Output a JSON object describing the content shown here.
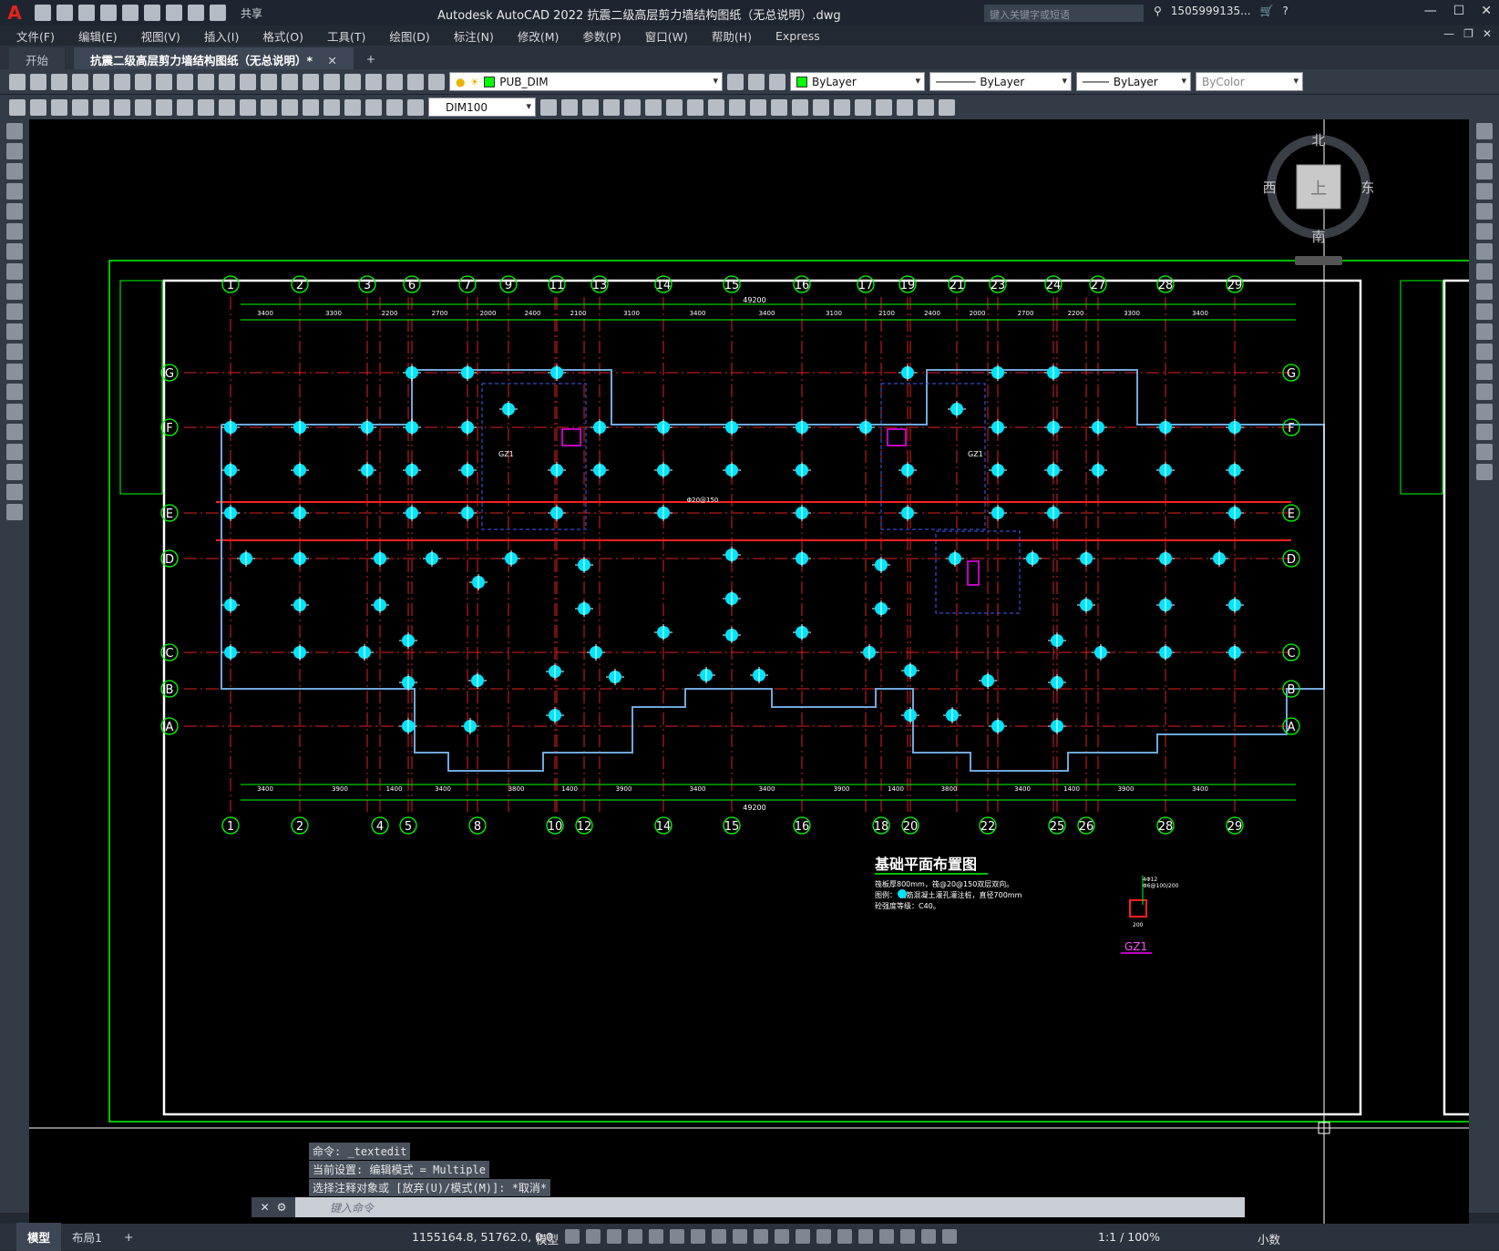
{
  "titlebar": {
    "app_title": "Autodesk AutoCAD 2022    抗震二级高层剪力墙结构图纸（无总说明）.dwg",
    "share_label": "共享",
    "search_placeholder": "键入关键字或短语",
    "user": "1505999135...",
    "logo": "A"
  },
  "menu": {
    "items": [
      "文件(F)",
      "编辑(E)",
      "视图(V)",
      "插入(I)",
      "格式(O)",
      "工具(T)",
      "绘图(D)",
      "标注(N)",
      "修改(M)",
      "参数(P)",
      "窗口(W)",
      "帮助(H)",
      "Express"
    ]
  },
  "tabs": {
    "start": "开始",
    "drawing": "抗震二级高层剪力墙结构图纸（无总说明）*"
  },
  "toolbar": {
    "layer_name": "PUB_DIM",
    "color": "ByLayer",
    "linetype": "ByLayer",
    "lineweight": "ByLayer",
    "plotstyle": "ByColor",
    "dimstyle": "DIM100",
    "layer_color": "#00ff00"
  },
  "viewcube": {
    "north": "北",
    "south": "南",
    "east": "东",
    "west": "西",
    "top": "上"
  },
  "drawing": {
    "top_axes": [
      "1",
      "2",
      "3",
      "6",
      "7",
      "9",
      "11",
      "13",
      "14",
      "15",
      "16",
      "17",
      "19",
      "21",
      "23",
      "24",
      "27",
      "28",
      "29"
    ],
    "bottom_axes": [
      "1",
      "2",
      "4",
      "5",
      "8",
      "10",
      "12",
      "14",
      "15",
      "16",
      "18",
      "20",
      "22",
      "25",
      "26",
      "28",
      "29"
    ],
    "row_axes": [
      "G",
      "F",
      "E",
      "D",
      "C",
      "B",
      "A"
    ],
    "top_dims": [
      "3400",
      "3300",
      "2200",
      "2700",
      "2000",
      "2400",
      "2100",
      "3100",
      "3400",
      "3400",
      "3100",
      "2100",
      "2400",
      "2000",
      "2700",
      "2200",
      "3300",
      "3400"
    ],
    "bottom_dims": [
      "3400",
      "3900",
      "1400",
      "3400",
      "3800",
      "1400",
      "3900",
      "3400",
      "3400",
      "3900",
      "1400",
      "3800",
      "3400",
      "1400",
      "3900",
      "3400"
    ],
    "total_dim": "49200",
    "plan_title": "基础平面布置图",
    "note1": "筏板厚800mm，筏@20@150双层双向。",
    "note2": "图例：   钢筋混凝土灌孔灌注桩，直径700mm",
    "note3": "砼强度等级：C40。",
    "gz1_label": "GZ1",
    "gz1_rebar1": "4Φ12",
    "gz1_rebar2": "Φ6@100/200",
    "gz1_dim": "200",
    "center_label": "Φ20@150"
  },
  "command": {
    "history1": "命令: _textedit",
    "history2": "当前设置: 编辑模式 = Multiple",
    "history3": "选择注释对象或 [放弃(U)/模式(M)]: *取消*",
    "placeholder": "键入命令"
  },
  "status": {
    "tab_model": "模型",
    "tab_layout": "布局1",
    "coords": "1155164.8, 51762.0, 0.0",
    "model": "模型",
    "scale": "1:1 / 100%",
    "units": "小数"
  }
}
